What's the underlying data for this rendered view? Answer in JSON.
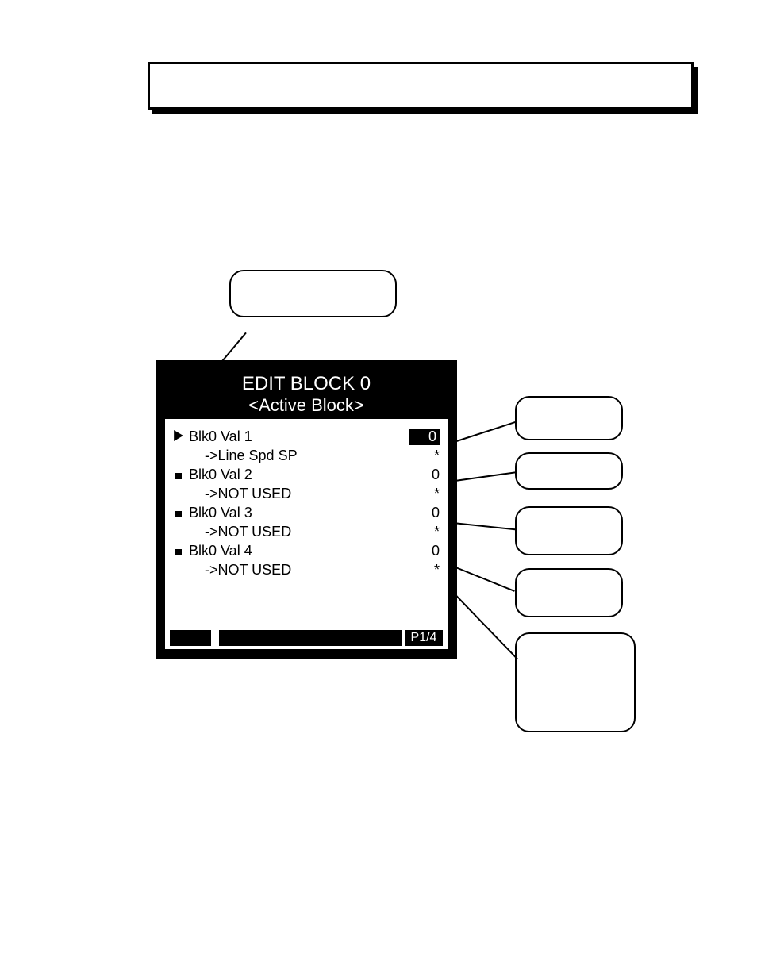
{
  "header": {
    "line1": "EDIT BLOCK 0",
    "line2": "<Active Block>"
  },
  "rows": [
    {
      "marker": "arrow",
      "label": "Blk0 Val 1",
      "value": "0",
      "selected": true,
      "sub": "->Line Spd SP",
      "ast": "*"
    },
    {
      "marker": "square",
      "label": "Blk0 Val 2",
      "value": "0",
      "selected": false,
      "sub": "->NOT USED",
      "ast": "*"
    },
    {
      "marker": "square",
      "label": "Blk0 Val 3",
      "value": "0",
      "selected": false,
      "sub": "->NOT USED",
      "ast": "*"
    },
    {
      "marker": "square",
      "label": "Blk0 Val 4",
      "value": "0",
      "selected": false,
      "sub": "->NOT USED",
      "ast": "*"
    }
  ],
  "page_indicator": "P1/4"
}
